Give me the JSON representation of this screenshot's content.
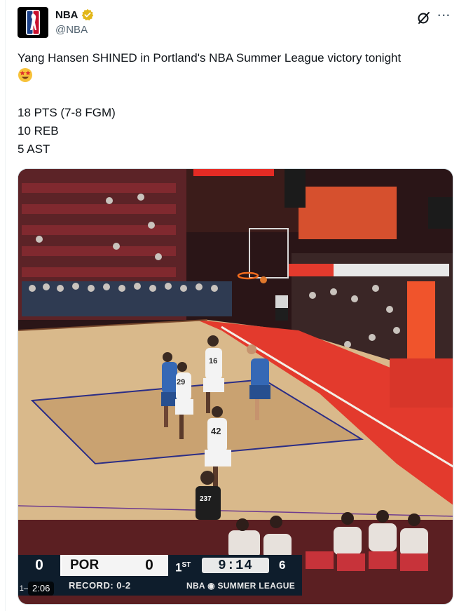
{
  "author": {
    "name": "NBA",
    "handle": "@NBA",
    "avatar_icon": "nba-logo-icon",
    "verified_icon": "verified-badge-icon",
    "verified_color": "#e2b719"
  },
  "actions": {
    "grok_icon": "grok-icon",
    "more_icon": "more-options-icon",
    "more_label": "···"
  },
  "tweet": {
    "line1": "Yang Hansen SHINED in Portland's NBA Summer League victory tonight",
    "emoji_icon": "star-struck-emoji-icon",
    "stats": [
      "18 PTS (7-8 FGM)",
      "10 REB",
      "5 AST"
    ]
  },
  "video": {
    "timestamp": "2:06",
    "scorebug": {
      "left_score": "0",
      "team": "POR",
      "team_score": "0",
      "quarter": "1",
      "quarter_suffix": "ST",
      "clock": "9:14",
      "shot_clock": "6",
      "record": "RECORD: 0-2",
      "league": "NBA",
      "league_suffix": "SUMMER LEAGUE"
    },
    "jersey_numbers": [
      "16",
      "29",
      "42",
      "237"
    ],
    "colors": {
      "court_wood": "#d9b98b",
      "paint_red": "#e33a2d",
      "scorebug_navy": "#0e1d2c"
    }
  }
}
